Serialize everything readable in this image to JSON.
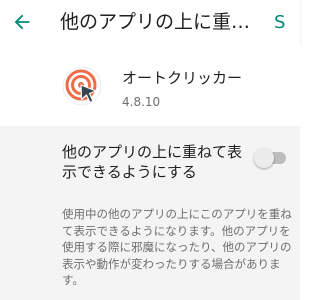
{
  "app_bar": {
    "title": "他のアプリの上に重ね…",
    "action_icon_text": "S",
    "accent_color": "#00897b"
  },
  "app": {
    "name": "オートクリッカー",
    "version": "4.8.10",
    "icon": "target-cursor-icon"
  },
  "setting": {
    "title": "他のアプリの上に重ねて表示できるようにする",
    "enabled": false,
    "description": "使用中の他のアプリの上にこのアプリを重ねて表示できるようになります。他のアプリを使用する際に邪魔になったり、他のアプリの表示や動作が変わったりする場合があります。"
  },
  "colors": {
    "background": "#ffffff",
    "content_background": "#f4f4f4",
    "icon_ring": "#ef6c47",
    "cursor": "#37474f"
  }
}
